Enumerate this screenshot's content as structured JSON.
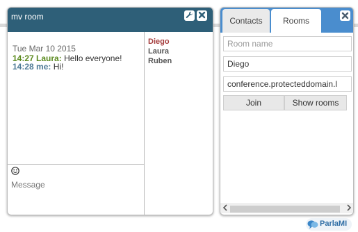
{
  "chatroom": {
    "title": "mv room",
    "date": "Tue Mar 10 2015",
    "messages": [
      {
        "time": "14:27",
        "sender": "Laura:",
        "text": "Hello everyone!"
      },
      {
        "time": "14:28",
        "sender": "me:",
        "text": "Hi!"
      }
    ],
    "occupants": [
      "Diego",
      "Laura",
      "Ruben"
    ],
    "composer": {
      "placeholder": "Message"
    }
  },
  "controlbox": {
    "tabs": {
      "contacts": "Contacts",
      "rooms": "Rooms"
    },
    "active_tab": "Rooms",
    "room_name": {
      "placeholder": "Room name",
      "value": ""
    },
    "nickname": {
      "value": "Diego"
    },
    "server": {
      "value": "conference.protecteddomain.l"
    },
    "buttons": {
      "join": "Join",
      "show_rooms": "Show rooms"
    }
  },
  "logo": {
    "text": "ParlaMI"
  },
  "colors": {
    "chat_header": "#2e5f78",
    "controlbox_header": "#4a8dce",
    "laura": "#5b8a1f",
    "me": "#4e7a96",
    "diego": "#a33a3a"
  },
  "icons": [
    "wrench-icon",
    "close-icon",
    "smiley-icon",
    "chevron-left-icon",
    "chevron-right-icon",
    "logo-icon"
  ]
}
